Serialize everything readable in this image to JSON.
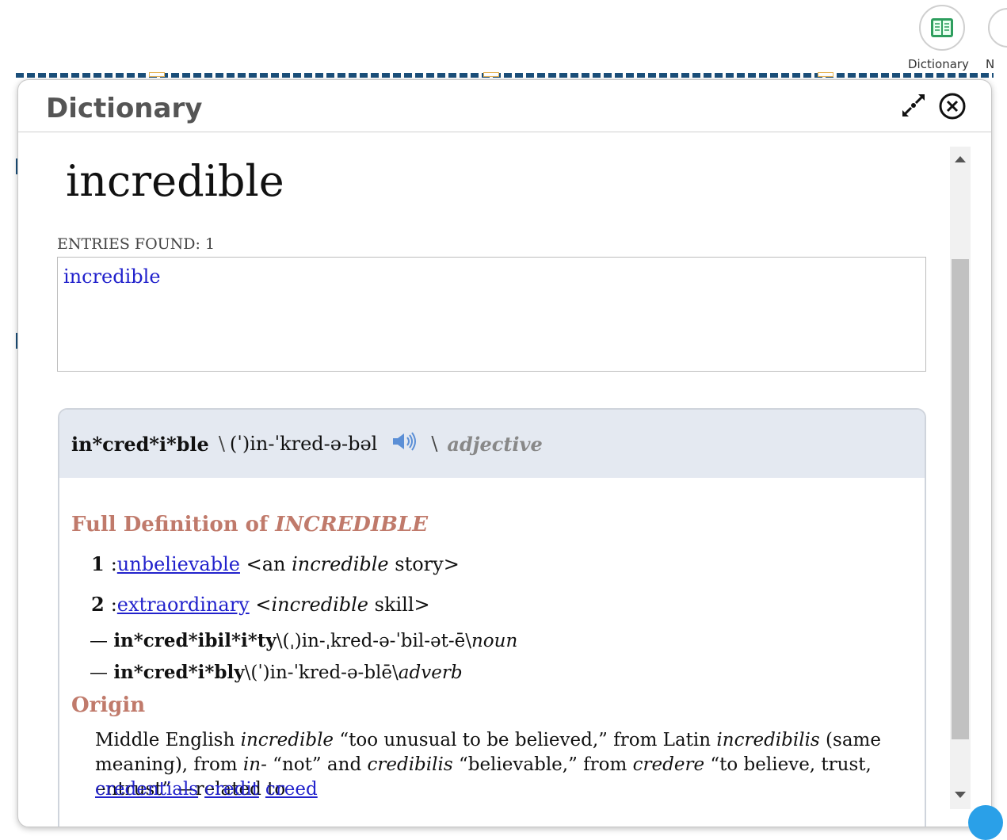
{
  "toolbar": {
    "dictionary_label": "Dictionary",
    "next_label_partial": "N"
  },
  "panel": {
    "title": "Dictionary"
  },
  "search": {
    "headword": "incredible",
    "entries_found": "ENTRIES FOUND: 1",
    "entries": [
      "incredible"
    ]
  },
  "entry": {
    "headword": "in*cred*i*ble",
    "pron_open": "\\",
    "pronunciation": "(ˈ)in-ˈkred-ə-bəl",
    "pron_close": "\\",
    "part_of_speech": "adjective",
    "definition_title": "Full Definition of ",
    "definition_title_word": "INCREDIBLE",
    "definitions": [
      {
        "num": "1",
        "colon": ":",
        "link": "unbelievable",
        "ex_pre": " <an ",
        "ex_it": "incredible",
        "ex_post": " story>"
      },
      {
        "num": "2",
        "colon": ":",
        "link": "extraordinary",
        "ex_pre": " <",
        "ex_it": "incredible",
        "ex_post": " skill>"
      }
    ],
    "run_ons": [
      {
        "dash": "— ",
        "word": "in*cred*ibil*i*ty",
        "pron": "\\(ˌ)in-ˌkred-ə-ˈbil-ət-ē\\",
        "pos": "noun"
      },
      {
        "dash": "— ",
        "word": "in*cred*i*bly",
        "pron": "\\(ˈ)in-ˈkred-ə-blē\\",
        "pos": "adverb"
      }
    ],
    "origin_title": "Origin",
    "origin_parts": [
      {
        "t": "Middle English ",
        "i": false
      },
      {
        "t": "incredible",
        "i": true
      },
      {
        "t": " “too unusual to be believed,” from Latin ",
        "i": false
      },
      {
        "t": "incredibilis",
        "i": true
      },
      {
        "t": " (same meaning), from ",
        "i": false
      },
      {
        "t": "in-",
        "i": true
      },
      {
        "t": " “not” and ",
        "i": false
      },
      {
        "t": "credibilis",
        "i": true
      },
      {
        "t": " “believable,” from ",
        "i": false
      },
      {
        "t": "credere",
        "i": true
      },
      {
        "t": " “to believe, trust, entrust” —related to",
        "i": false
      }
    ],
    "related_links": [
      "credentials",
      "credit",
      "creed"
    ]
  },
  "colors": {
    "accent_heading": "#c07a6b",
    "link": "#2222cc",
    "entry_header_bg": "#e4e9f1"
  }
}
